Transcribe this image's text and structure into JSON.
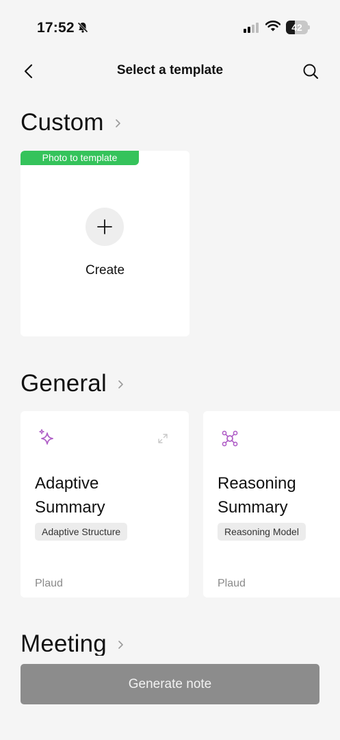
{
  "status_bar": {
    "time": "17:52",
    "battery_percent": "42",
    "battery_level": 0.42,
    "icons": [
      "bell-slash-icon",
      "cellular-signal-icon",
      "wifi-icon",
      "battery-icon"
    ]
  },
  "header": {
    "title": "Select a template",
    "back_icon": "chevron-left-icon",
    "search_icon": "search-icon"
  },
  "sections": {
    "custom": {
      "title": "Custom",
      "badge": "Photo to template",
      "create_label": "Create"
    },
    "general": {
      "title": "General",
      "cards": [
        {
          "title_line1": "Adaptive",
          "title_line2": "Summary",
          "tag": "Adaptive Structure",
          "author": "Plaud",
          "icon": "sparkle-icon"
        },
        {
          "title_line1": "Reasoning",
          "title_line2": "Summary",
          "tag": "Reasoning Model",
          "author": "Plaud",
          "icon": "network-nodes-icon"
        }
      ]
    },
    "meeting": {
      "title": "Meeting"
    }
  },
  "footer": {
    "generate_label": "Generate note"
  },
  "colors": {
    "background": "#f5f5f5",
    "card": "#ffffff",
    "badge_green": "#35c35b",
    "icon_purple": "#b05fc7",
    "button_disabled": "#8c8c8c"
  }
}
